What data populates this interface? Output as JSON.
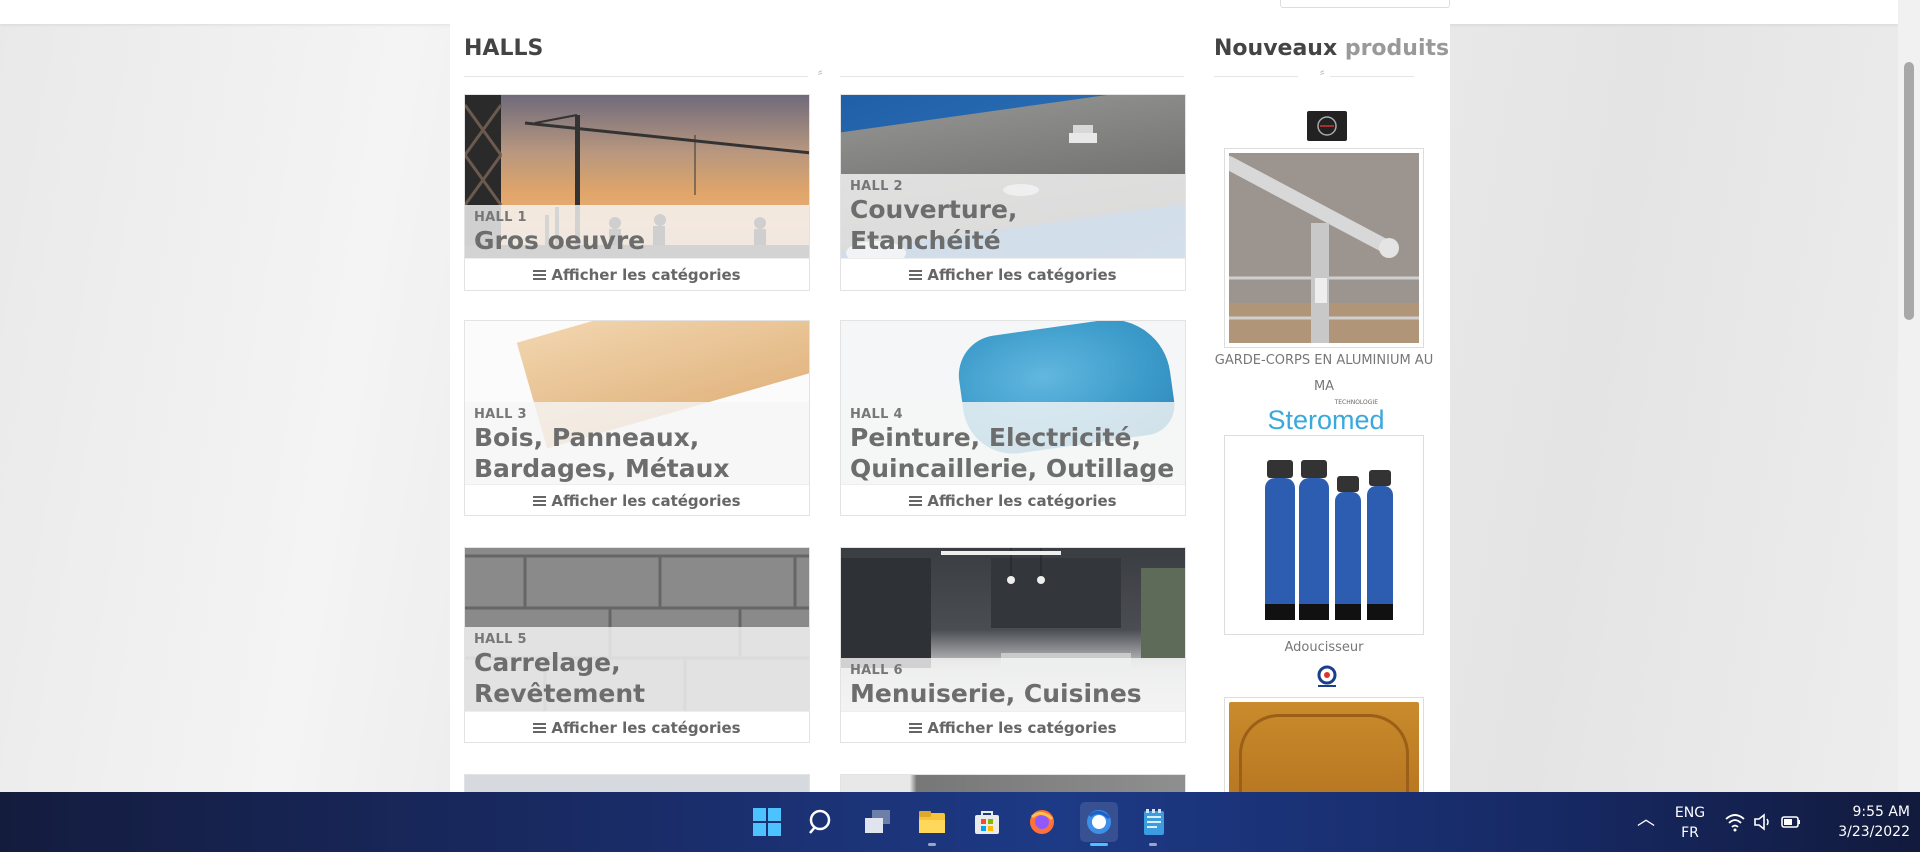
{
  "halls_section": {
    "title": "HALLS"
  },
  "new_products_section": {
    "title_bold": "Nouveaux",
    "title_light": "produits"
  },
  "halls": [
    {
      "number": "HALL 1",
      "name": "Gros oeuvre",
      "link": "Afficher les catégories"
    },
    {
      "number": "HALL 2",
      "name": "Couverture, Etanchéité",
      "link": "Afficher les catégories"
    },
    {
      "number": "HALL 3",
      "name": "Bois, Panneaux, Bardages, Métaux",
      "link": "Afficher les catégories"
    },
    {
      "number": "HALL 4",
      "name": "Peinture, Electricité, Quincaillerie, Outillage",
      "link": "Afficher les catégories"
    },
    {
      "number": "HALL 5",
      "name": "Carrelage, Revêtement",
      "link": "Afficher les catégories"
    },
    {
      "number": "HALL 6",
      "name": "Menuiserie, Cuisines",
      "link": "Afficher les catégories"
    }
  ],
  "products": [
    {
      "name": "GARDE-CORPS EN ALUMINIUM AU MA"
    },
    {
      "name": "Adoucisseur",
      "brand_logo_text": "Steromed",
      "brand_logo_sub": "TECHNOLOGIE"
    }
  ],
  "taskbar": {
    "language_primary": "ENG",
    "language_secondary": "FR",
    "time": "9:55 AM",
    "date": "3/23/2022"
  },
  "colors": {
    "taskbar_bg": "#1a2d6a",
    "heading_text": "#444444",
    "hall_name_text": "#6d6d6d",
    "steromed_blue": "#39a9dc"
  }
}
